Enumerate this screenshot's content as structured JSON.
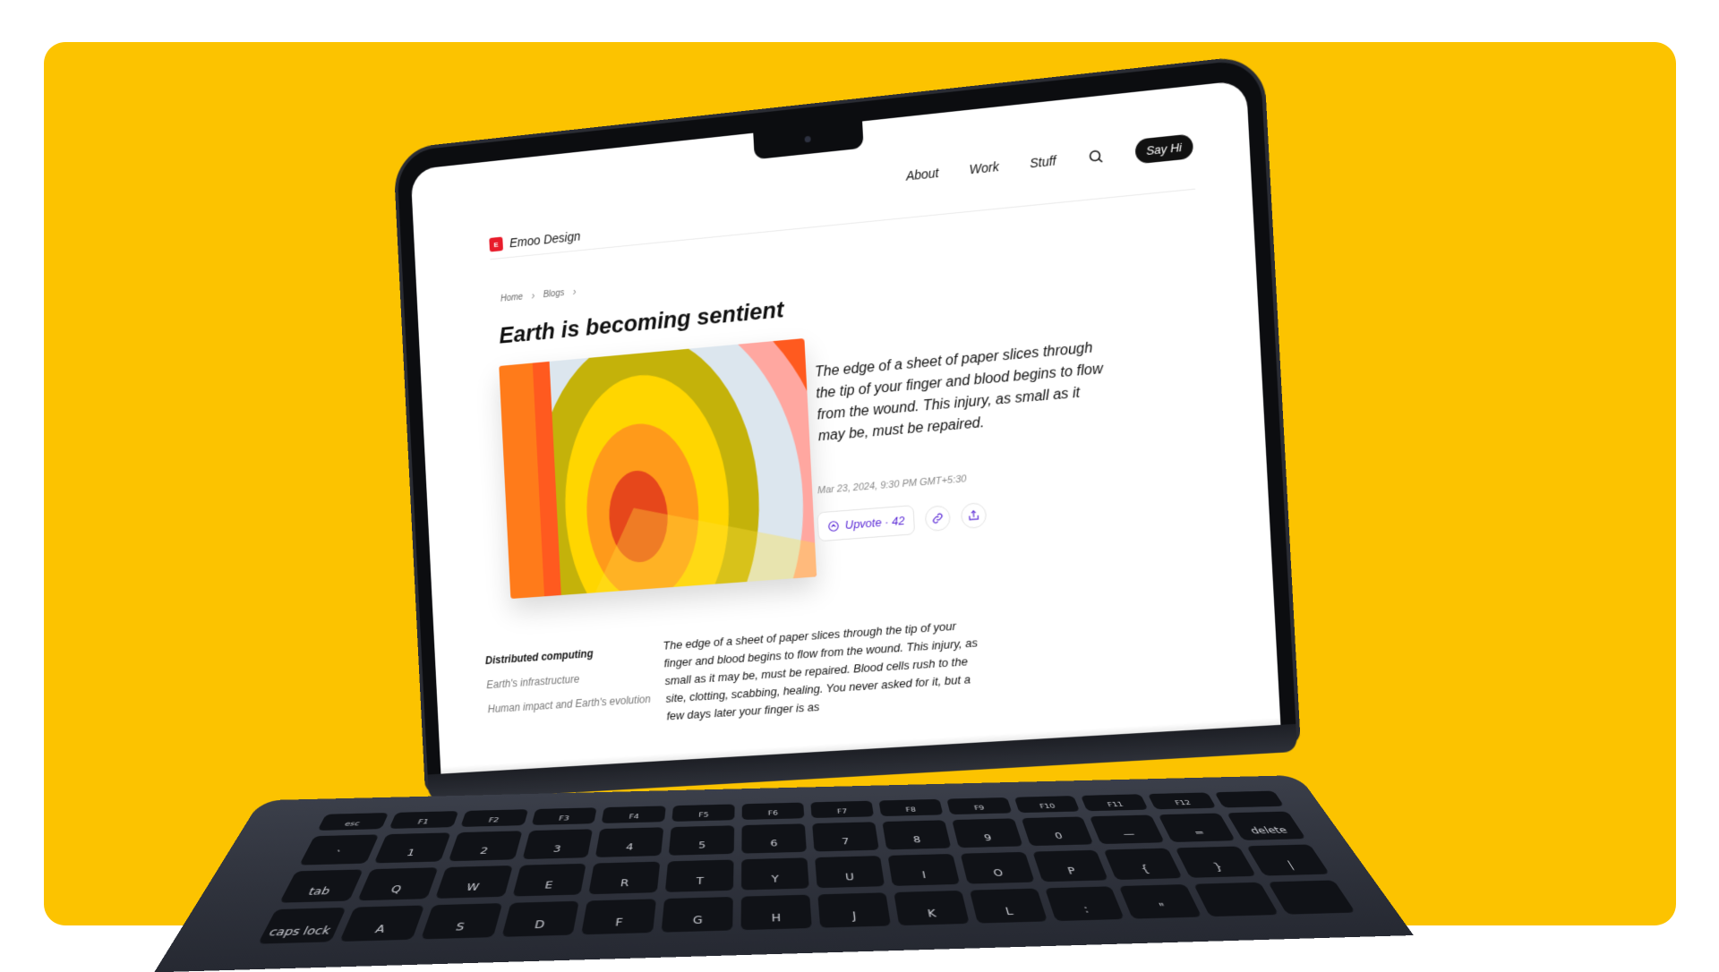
{
  "colors": {
    "backdrop": "#FCC300",
    "accent": "#5b2ad6",
    "logo": "#e81c2b"
  },
  "nav": {
    "brand": "Emoo Design",
    "items": [
      "About",
      "Work",
      "Stuff"
    ],
    "cta": "Say Hi",
    "search_icon": "search-icon"
  },
  "breadcrumb": [
    "Home",
    "Blogs"
  ],
  "article": {
    "title": "Earth is becoming sentient",
    "excerpt": "The edge of a sheet of paper slices through the tip of your finger and blood begins to flow from the wound. This injury, as small as it may be, must be repaired.",
    "date": "Mar 23, 2024, 9:30 PM GMT+5:30",
    "upvote_label": "Upvote · 42",
    "toc": [
      "Distributed computing",
      "Earth's infrastructure",
      "Human impact and Earth's evolution"
    ],
    "body": "The edge of a sheet of paper slices through the tip of your finger and blood begins to flow from the wound. This injury, as small as it may be, must be repaired. Blood cells rush to the site, clotting, scabbing, healing. You never asked for it, but a few days later your finger is as"
  },
  "keyboard": {
    "fn_row": [
      "esc",
      "F1",
      "F2",
      "F3",
      "F4",
      "F5",
      "F6",
      "F7",
      "F8",
      "F9",
      "F10",
      "F11",
      "F12",
      ""
    ],
    "num_row": [
      "`",
      "1",
      "2",
      "3",
      "4",
      "5",
      "6",
      "7",
      "8",
      "9",
      "0",
      "—",
      "=",
      "delete"
    ],
    "qwerty_row": [
      "tab",
      "Q",
      "W",
      "E",
      "R",
      "T",
      "Y",
      "U",
      "I",
      "O",
      "P",
      "{",
      "}",
      "|"
    ],
    "home_row": [
      "caps lock",
      "A",
      "S",
      "D",
      "F",
      "G",
      "H",
      "J",
      "K",
      "L",
      ":",
      "\"",
      "",
      ""
    ]
  }
}
